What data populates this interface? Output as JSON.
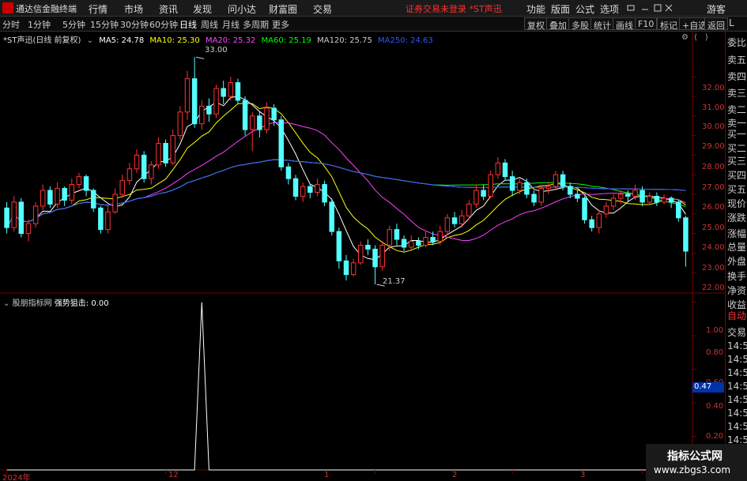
{
  "topbar": {
    "app_name": "通达信金融终端",
    "menus": [
      "行情",
      "市场",
      "资讯",
      "发现",
      "问小达",
      "财富圈",
      "交易"
    ],
    "warning": "证券交易未登录  *ST声迅",
    "right_menus": [
      "功能",
      "版面",
      "公式",
      "选项"
    ],
    "guest": "游客"
  },
  "periods": [
    "分时",
    "1分钟",
    "5分钟",
    "15分钟",
    "30分钟",
    "60分钟",
    "日线",
    "周线",
    "月线",
    "多周期",
    "更多"
  ],
  "active_period": "日线",
  "right_buttons": [
    "复权",
    "叠加",
    "多股",
    "统计",
    "画线",
    "F10",
    "标记",
    "+自选",
    "返回"
  ],
  "chart_info": {
    "stock": "*ST声迅(日线 前复权)",
    "ma": [
      {
        "label": "MA5: 24.78",
        "color": "#ffffff"
      },
      {
        "label": "MA10: 25.30",
        "color": "#ffff00"
      },
      {
        "label": "MA20: 25.32",
        "color": "#ff40ff"
      },
      {
        "label": "MA60: 25.19",
        "color": "#00ff00"
      },
      {
        "label": "MA120: 25.75",
        "color": "#cccccc"
      },
      {
        "label": "MA250: 24.63",
        "color": "#3355ff"
      }
    ]
  },
  "sub_info": {
    "name": "股朋指标网",
    "label": "强势狙击",
    "value": ": 0.00"
  },
  "price_axis": [
    "32.00",
    "31.00",
    "30.00",
    "29.00",
    "28.00",
    "27.00",
    "26.00",
    "25.00",
    "24.00",
    "23.00",
    "22.00"
  ],
  "sub_axis": [
    "1.00",
    "0.80",
    "0.60",
    "0.40",
    "0.20"
  ],
  "sub_axis_marker": "0.47",
  "annotations": {
    "high": "33.00",
    "low": "21.37"
  },
  "x_axis": [
    "2024年",
    "12",
    "1",
    "2",
    "3"
  ],
  "right_panel": [
    "委比",
    "卖五",
    "卖四",
    "卖三",
    "卖二",
    "卖一",
    "买一",
    "买二",
    "买三",
    "买四",
    "买五",
    "现价",
    "涨跌",
    "涨幅",
    "总量",
    "外盘",
    "换手",
    "净资",
    "收益",
    "自动",
    "交易",
    "14:55",
    "14:55",
    "14:55",
    "14:55",
    "14:56",
    "14:56",
    "14:56",
    "14:56",
    "14:56"
  ],
  "right_header": "L",
  "watermark": {
    "line1": "指标公式网",
    "line2": "www.zbgs3.com"
  },
  "colors": {
    "up": "#ff3232",
    "down": "#54ffff",
    "grid": "#7a0000"
  },
  "chart_data": [
    {
      "type": "candlestick",
      "title": "*ST声迅(日线 前复权)",
      "y_range": [
        21.0,
        33.5
      ],
      "candles": [
        [
          25.3,
          24.3,
          25.6,
          24.0
        ],
        [
          24.3,
          25.6,
          25.9,
          24.1
        ],
        [
          25.6,
          24.0,
          25.8,
          23.8
        ],
        [
          24.0,
          24.5,
          24.7,
          23.6
        ],
        [
          24.5,
          25.4,
          25.6,
          24.3
        ],
        [
          25.4,
          26.2,
          26.5,
          25.2
        ],
        [
          26.2,
          25.5,
          26.4,
          25.3
        ],
        [
          25.5,
          26.3,
          26.6,
          25.3
        ],
        [
          26.3,
          25.7,
          26.4,
          25.4
        ],
        [
          25.7,
          26.5,
          26.8,
          25.5
        ],
        [
          26.5,
          26.9,
          27.1,
          26.3
        ],
        [
          26.9,
          26.2,
          27.0,
          25.9
        ],
        [
          26.2,
          25.3,
          26.3,
          25.1
        ],
        [
          25.3,
          24.2,
          25.4,
          24.0
        ],
        [
          24.2,
          25.1,
          25.4,
          24.0
        ],
        [
          25.1,
          26.0,
          26.3,
          25.0
        ],
        [
          26.0,
          26.7,
          27.0,
          25.8
        ],
        [
          26.7,
          27.3,
          27.6,
          26.5
        ],
        [
          27.3,
          28.0,
          28.3,
          27.1
        ],
        [
          28.0,
          26.8,
          28.2,
          26.6
        ],
        [
          26.8,
          27.5,
          27.7,
          26.5
        ],
        [
          27.5,
          28.6,
          28.9,
          27.3
        ],
        [
          28.6,
          27.6,
          28.8,
          27.4
        ],
        [
          27.6,
          29.0,
          29.3,
          27.5
        ],
        [
          29.0,
          30.2,
          30.5,
          28.8
        ],
        [
          30.2,
          31.9,
          32.3,
          29.8
        ],
        [
          31.9,
          29.6,
          33.0,
          29.4
        ],
        [
          29.6,
          30.5,
          30.8,
          29.3
        ],
        [
          30.5,
          30.1,
          30.9,
          29.7
        ],
        [
          30.1,
          31.4,
          31.6,
          29.9
        ],
        [
          31.4,
          31.0,
          31.8,
          30.6
        ],
        [
          31.0,
          31.7,
          32.0,
          30.8
        ],
        [
          31.7,
          30.8,
          31.9,
          30.6
        ],
        [
          30.8,
          29.3,
          31.0,
          29.0
        ],
        [
          29.3,
          30.0,
          30.2,
          28.2
        ],
        [
          30.0,
          29.3,
          30.2,
          28.9
        ],
        [
          29.3,
          30.4,
          30.7,
          29.1
        ],
        [
          30.4,
          29.8,
          30.6,
          29.5
        ],
        [
          29.8,
          27.4,
          30.0,
          27.2
        ],
        [
          27.4,
          26.8,
          27.6,
          26.5
        ],
        [
          26.8,
          25.9,
          27.0,
          25.7
        ],
        [
          25.9,
          26.4,
          26.6,
          25.6
        ],
        [
          26.4,
          26.1,
          26.5,
          25.8
        ],
        [
          26.1,
          26.5,
          26.8,
          25.9
        ],
        [
          26.5,
          25.6,
          26.7,
          25.4
        ],
        [
          25.6,
          24.1,
          25.8,
          23.9
        ],
        [
          24.1,
          22.6,
          24.3,
          22.2
        ],
        [
          22.6,
          21.9,
          22.9,
          21.6
        ],
        [
          21.9,
          22.5,
          22.7,
          21.8
        ],
        [
          22.5,
          23.4,
          23.6,
          22.4
        ],
        [
          23.4,
          23.2,
          23.7,
          22.9
        ],
        [
          23.2,
          22.3,
          23.4,
          21.4
        ],
        [
          22.3,
          23.4,
          23.6,
          22.1
        ],
        [
          23.4,
          24.2,
          24.4,
          23.1
        ],
        [
          24.2,
          23.7,
          24.5,
          23.4
        ],
        [
          23.7,
          23.3,
          23.9,
          23.1
        ],
        [
          23.3,
          23.6,
          23.9,
          23.1
        ],
        [
          23.6,
          23.4,
          23.8,
          23.2
        ],
        [
          23.4,
          23.8,
          24.1,
          23.3
        ],
        [
          23.8,
          23.6,
          24.1,
          23.4
        ],
        [
          23.6,
          24.1,
          24.4,
          23.4
        ],
        [
          24.1,
          24.8,
          25.0,
          23.9
        ],
        [
          24.8,
          24.5,
          25.1,
          24.3
        ],
        [
          24.5,
          24.9,
          25.2,
          24.3
        ],
        [
          24.9,
          25.5,
          25.7,
          24.7
        ],
        [
          25.5,
          26.2,
          26.5,
          25.3
        ],
        [
          26.2,
          25.9,
          26.5,
          25.7
        ],
        [
          25.9,
          27.0,
          27.2,
          25.8
        ],
        [
          27.0,
          27.6,
          27.9,
          26.8
        ],
        [
          27.6,
          26.9,
          27.8,
          26.7
        ],
        [
          26.9,
          26.2,
          27.2,
          25.9
        ],
        [
          26.2,
          26.6,
          26.8,
          26.0
        ],
        [
          26.6,
          26.0,
          26.8,
          25.8
        ],
        [
          26.0,
          25.6,
          26.2,
          25.4
        ],
        [
          25.6,
          26.3,
          26.5,
          25.4
        ],
        [
          26.3,
          26.4,
          26.6,
          26.0
        ],
        [
          26.4,
          27.0,
          27.2,
          26.2
        ],
        [
          27.0,
          26.4,
          27.2,
          26.2
        ],
        [
          26.4,
          26.0,
          26.6,
          25.8
        ],
        [
          26.0,
          25.8,
          26.2,
          25.6
        ],
        [
          25.8,
          24.7,
          25.9,
          24.5
        ],
        [
          24.7,
          24.3,
          24.9,
          24.1
        ],
        [
          24.3,
          25.0,
          25.2,
          24.0
        ],
        [
          25.0,
          25.4,
          25.6,
          24.8
        ],
        [
          25.4,
          25.8,
          26.0,
          25.2
        ],
        [
          25.8,
          26.0,
          26.2,
          25.5
        ],
        [
          26.0,
          25.9,
          26.2,
          25.6
        ],
        [
          25.9,
          26.2,
          26.5,
          25.7
        ],
        [
          26.2,
          25.6,
          26.4,
          25.4
        ],
        [
          25.6,
          25.9,
          26.1,
          25.5
        ],
        [
          25.9,
          25.6,
          26.1,
          25.4
        ],
        [
          25.6,
          25.8,
          26.0,
          25.5
        ],
        [
          25.8,
          25.6,
          25.9,
          25.3
        ],
        [
          25.6,
          24.8,
          25.7,
          24.6
        ],
        [
          24.8,
          23.1,
          24.9,
          22.3
        ]
      ]
    },
    {
      "type": "line",
      "title": "强势狙击",
      "y_range": [
        0,
        1.05
      ],
      "values": [
        0,
        0,
        0,
        0,
        0,
        0,
        0,
        0,
        0,
        0,
        0,
        0,
        0,
        0,
        0,
        0,
        0,
        0,
        0,
        0,
        0,
        0,
        0,
        0,
        0,
        0,
        0,
        1,
        0,
        0,
        0,
        0,
        0,
        0,
        0,
        0,
        0,
        0,
        0,
        0,
        0,
        0,
        0,
        0,
        0,
        0,
        0,
        0,
        0,
        0,
        0,
        0,
        0,
        0,
        0,
        0,
        0,
        0,
        0,
        0,
        0,
        0,
        0,
        0,
        0,
        0,
        0,
        0,
        0,
        0,
        0,
        0,
        0,
        0,
        0,
        0,
        0,
        0,
        0,
        0,
        0,
        0,
        0,
        0,
        0,
        0,
        0,
        0,
        0,
        0,
        0,
        0,
        0,
        0,
        0
      ]
    }
  ]
}
